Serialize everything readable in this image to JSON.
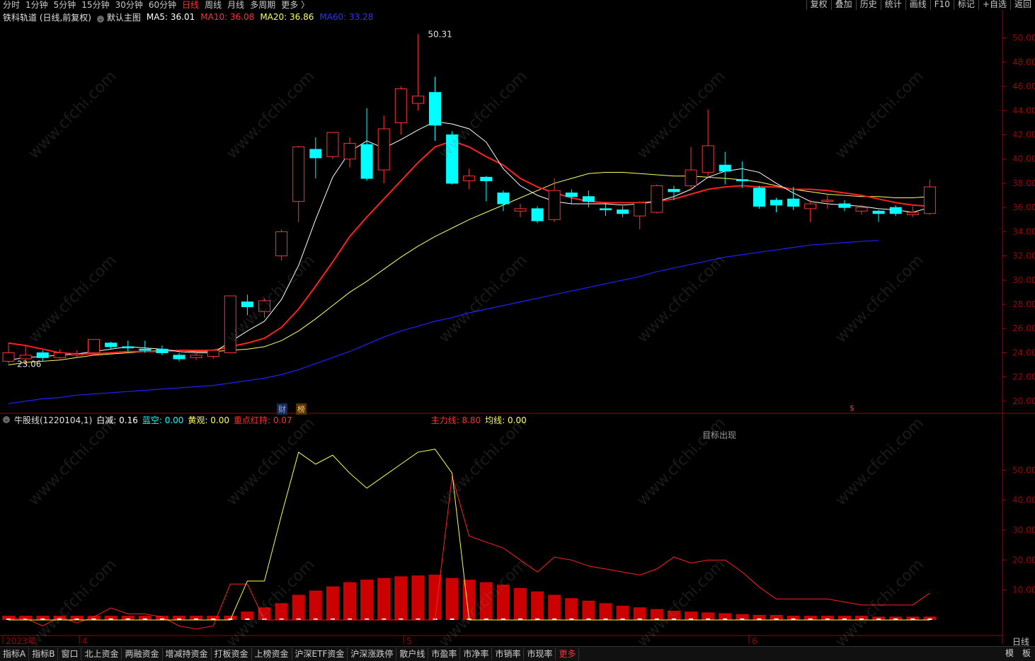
{
  "toolbar": {
    "items": [
      {
        "label": "分时",
        "active": false
      },
      {
        "label": "1分钟",
        "active": false
      },
      {
        "label": "5分钟",
        "active": false
      },
      {
        "label": "15分钟",
        "active": false
      },
      {
        "label": "30分钟",
        "active": false
      },
      {
        "label": "60分钟",
        "active": false
      },
      {
        "label": "日线",
        "active": true
      },
      {
        "label": "周线",
        "active": false
      },
      {
        "label": "月线",
        "active": false
      },
      {
        "label": "多周期",
        "active": false
      },
      {
        "label": "更多 〉",
        "active": false
      }
    ],
    "right": [
      "复权",
      "叠加",
      "历史",
      "统计",
      "画线",
      "F10",
      "标记",
      "+自选",
      "返回"
    ]
  },
  "main_header": {
    "stock": "铁科轨道 (日线,前复权)",
    "template": "默认主图",
    "ma5": "MA5: 36.01",
    "ma10": "MA10: 36.08",
    "ma20": "MA20: 36.86",
    "ma60": "MA60: 33.28"
  },
  "indicator_header": {
    "name": "牛股线(1220104,1)",
    "baijian": "白减: 0.16",
    "lankong": "蓝空: 0.00",
    "huangguan": "黄观: 0.00",
    "zhongdian": "重点红持: 0.07",
    "zhuli": "主力线: 8.80",
    "junxian": "均线: 0.00"
  },
  "annotations": {
    "high": "50.31",
    "low": "23.06",
    "target": "目标出现",
    "cai": "财",
    "bang": "榜",
    "dollar": "$"
  },
  "date_axis": [
    {
      "label": "2023年"
    },
    {
      "label": "4"
    },
    {
      "label": "5"
    },
    {
      "label": "6"
    }
  ],
  "period": "日线",
  "bottom_tabs": [
    "指标A",
    "指标B",
    "窗口",
    "北上资金",
    "两融资金",
    "增减持资金",
    "打板资金",
    "上榜资金",
    "沪深ETF资金",
    "沪深涨跌停",
    "散户线",
    "市盈率",
    "市净率",
    "市销率",
    "市现率",
    "更多"
  ],
  "bottom_right": [
    "模",
    "板"
  ],
  "watermark": "www.cfchi.com",
  "colors": {
    "up": "#ff3232",
    "down": "#00ffff",
    "ma5": "#ffffff",
    "ma10": "#ff2020",
    "ma20": "#ffff66",
    "ma60": "#2020ff",
    "axis": "#a00000"
  },
  "chart_data": {
    "type": "candlestick",
    "price_axis": {
      "ticks": [
        20.0,
        22.0,
        24.0,
        26.0,
        28.0,
        30.0,
        32.0,
        34.0,
        36.0,
        38.0,
        40.0,
        42.0,
        44.0,
        46.0,
        48.0,
        50.0
      ]
    },
    "indicator_axis": {
      "ticks": [
        10.0,
        20.0,
        30.0,
        40.0,
        50.0
      ]
    },
    "candles": [
      {
        "o": 23.3,
        "c": 24.0,
        "h": 24.8,
        "l": 23.1
      },
      {
        "o": 23.5,
        "c": 23.8,
        "h": 24.6,
        "l": 23.0
      },
      {
        "o": 24.0,
        "c": 23.6,
        "h": 24.2,
        "l": 23.3
      },
      {
        "o": 23.6,
        "c": 24.0,
        "h": 24.3,
        "l": 23.5
      },
      {
        "o": 23.8,
        "c": 23.9,
        "h": 24.2,
        "l": 23.6
      },
      {
        "o": 24.0,
        "c": 25.1,
        "h": 25.1,
        "l": 23.9
      },
      {
        "o": 24.8,
        "c": 24.5,
        "h": 24.9,
        "l": 24.3
      },
      {
        "o": 24.5,
        "c": 24.4,
        "h": 25.0,
        "l": 24.1
      },
      {
        "o": 24.3,
        "c": 24.2,
        "h": 25.0,
        "l": 24.0
      },
      {
        "o": 24.3,
        "c": 24.0,
        "h": 24.6,
        "l": 23.8
      },
      {
        "o": 23.8,
        "c": 23.5,
        "h": 24.0,
        "l": 23.3
      },
      {
        "o": 23.6,
        "c": 23.8,
        "h": 24.1,
        "l": 23.4
      },
      {
        "o": 23.7,
        "c": 24.2,
        "h": 24.3,
        "l": 23.5
      },
      {
        "o": 24.0,
        "c": 28.7,
        "h": 28.7,
        "l": 24.0
      },
      {
        "o": 28.2,
        "c": 27.8,
        "h": 28.8,
        "l": 27.1
      },
      {
        "o": 27.4,
        "c": 28.3,
        "h": 28.5,
        "l": 26.9
      },
      {
        "o": 32.0,
        "c": 34.0,
        "h": 34.2,
        "l": 31.6
      },
      {
        "o": 36.5,
        "c": 41.0,
        "h": 41.1,
        "l": 34.8
      },
      {
        "o": 40.8,
        "c": 40.1,
        "h": 41.8,
        "l": 38.4
      },
      {
        "o": 40.2,
        "c": 42.2,
        "h": 42.2,
        "l": 40.0
      },
      {
        "o": 40.0,
        "c": 41.3,
        "h": 41.8,
        "l": 39.3
      },
      {
        "o": 41.2,
        "c": 38.4,
        "h": 44.2,
        "l": 38.2
      },
      {
        "o": 39.1,
        "c": 42.5,
        "h": 43.6,
        "l": 38.0
      },
      {
        "o": 43.0,
        "c": 45.8,
        "h": 46.0,
        "l": 42.0
      },
      {
        "o": 44.6,
        "c": 45.2,
        "h": 50.31,
        "l": 44.0
      },
      {
        "o": 45.5,
        "c": 42.8,
        "h": 46.8,
        "l": 41.5
      },
      {
        "o": 42.0,
        "c": 38.0,
        "h": 42.3,
        "l": 37.9
      },
      {
        "o": 38.2,
        "c": 38.6,
        "h": 39.2,
        "l": 37.5
      },
      {
        "o": 38.5,
        "c": 38.2,
        "h": 38.6,
        "l": 36.5
      },
      {
        "o": 37.2,
        "c": 36.3,
        "h": 37.4,
        "l": 35.7
      },
      {
        "o": 35.7,
        "c": 35.9,
        "h": 36.3,
        "l": 35.2
      },
      {
        "o": 35.9,
        "c": 34.9,
        "h": 36.1,
        "l": 34.7
      },
      {
        "o": 35.0,
        "c": 37.4,
        "h": 38.4,
        "l": 34.8
      },
      {
        "o": 37.2,
        "c": 36.9,
        "h": 37.5,
        "l": 36.3
      },
      {
        "o": 36.9,
        "c": 36.5,
        "h": 37.4,
        "l": 36.0
      },
      {
        "o": 35.9,
        "c": 35.8,
        "h": 36.4,
        "l": 35.3
      },
      {
        "o": 35.8,
        "c": 35.5,
        "h": 36.1,
        "l": 35.2
      },
      {
        "o": 35.3,
        "c": 36.4,
        "h": 36.5,
        "l": 34.2
      },
      {
        "o": 35.6,
        "c": 37.8,
        "h": 37.9,
        "l": 35.5
      },
      {
        "o": 37.5,
        "c": 37.3,
        "h": 37.8,
        "l": 36.6
      },
      {
        "o": 37.8,
        "c": 39.1,
        "h": 41.0,
        "l": 37.4
      },
      {
        "o": 38.9,
        "c": 41.1,
        "h": 44.1,
        "l": 38.6
      },
      {
        "o": 39.5,
        "c": 39.0,
        "h": 40.6,
        "l": 37.9
      },
      {
        "o": 38.3,
        "c": 38.2,
        "h": 39.8,
        "l": 37.6
      },
      {
        "o": 37.6,
        "c": 36.1,
        "h": 37.8,
        "l": 35.9
      },
      {
        "o": 36.6,
        "c": 36.2,
        "h": 36.8,
        "l": 35.6
      },
      {
        "o": 36.7,
        "c": 36.1,
        "h": 37.7,
        "l": 35.8
      },
      {
        "o": 35.9,
        "c": 36.3,
        "h": 36.6,
        "l": 34.8
      },
      {
        "o": 36.5,
        "c": 36.6,
        "h": 37.0,
        "l": 35.9
      },
      {
        "o": 36.3,
        "c": 36.0,
        "h": 36.6,
        "l": 35.7
      },
      {
        "o": 35.7,
        "c": 36.0,
        "h": 36.2,
        "l": 35.4
      },
      {
        "o": 35.7,
        "c": 35.5,
        "h": 35.8,
        "l": 34.8
      },
      {
        "o": 36.0,
        "c": 35.5,
        "h": 36.2,
        "l": 35.3
      },
      {
        "o": 35.4,
        "c": 35.6,
        "h": 36.1,
        "l": 35.2
      },
      {
        "o": 35.5,
        "c": 37.7,
        "h": 38.3,
        "l": 35.4
      }
    ],
    "ma5": [
      23.4,
      23.6,
      23.7,
      23.8,
      23.9,
      24.1,
      24.3,
      24.5,
      24.4,
      24.3,
      24.1,
      24.0,
      24.0,
      24.9,
      25.8,
      26.6,
      28.4,
      31.2,
      35.0,
      38.5,
      40.6,
      41.5,
      40.9,
      41.6,
      42.4,
      43.1,
      42.9,
      42.5,
      41.4,
      39.2,
      37.8,
      37.0,
      36.5,
      36.3,
      36.3,
      36.3,
      36.2,
      36.3,
      36.5,
      36.9,
      37.5,
      38.5,
      39.0,
      39.2,
      38.9,
      38.0,
      37.2,
      36.5,
      36.3,
      36.2,
      36.1,
      35.9,
      35.8,
      35.6,
      36.0
    ],
    "ma10": [
      24.8,
      24.6,
      24.3,
      24.0,
      23.9,
      23.9,
      24.0,
      24.1,
      24.1,
      24.1,
      24.2,
      24.2,
      24.2,
      24.5,
      24.8,
      25.2,
      26.1,
      27.6,
      29.5,
      31.5,
      33.6,
      35.2,
      36.7,
      38.2,
      39.7,
      41.0,
      41.5,
      41.0,
      40.2,
      39.5,
      38.4,
      37.7,
      37.2,
      36.8,
      36.5,
      36.4,
      36.4,
      36.4,
      36.5,
      36.7,
      37.1,
      37.5,
      37.7,
      37.8,
      37.7,
      37.7,
      37.5,
      37.5,
      37.4,
      37.2,
      37.0,
      36.7,
      36.4,
      36.2,
      36.1
    ],
    "ma20": [
      23.0,
      23.2,
      23.3,
      23.4,
      23.6,
      23.8,
      23.9,
      24.0,
      24.1,
      24.2,
      24.2,
      24.1,
      24.1,
      24.2,
      24.3,
      24.5,
      25.0,
      25.8,
      26.8,
      27.9,
      29.0,
      29.9,
      30.9,
      31.9,
      32.8,
      33.6,
      34.3,
      35.0,
      35.6,
      36.2,
      36.8,
      37.4,
      38.0,
      38.4,
      38.8,
      38.9,
      38.9,
      38.8,
      38.7,
      38.6,
      38.6,
      38.5,
      38.4,
      38.3,
      38.1,
      37.8,
      37.5,
      37.3,
      37.1,
      37.0,
      36.9,
      36.9,
      36.8,
      36.8,
      36.9
    ],
    "ma60": [
      19.8,
      20.0,
      20.2,
      20.3,
      20.5,
      20.6,
      20.7,
      20.8,
      20.9,
      21.0,
      21.1,
      21.2,
      21.3,
      21.5,
      21.7,
      21.9,
      22.2,
      22.6,
      23.1,
      23.6,
      24.1,
      24.7,
      25.3,
      25.8,
      26.2,
      26.6,
      26.9,
      27.3,
      27.6,
      27.9,
      28.2,
      28.5,
      28.8,
      29.1,
      29.4,
      29.7,
      30.0,
      30.3,
      30.7,
      31.0,
      31.3,
      31.6,
      31.9,
      32.1,
      32.3,
      32.5,
      32.7,
      32.9,
      33.0,
      33.1,
      33.2,
      33.28
    ],
    "zhuli_yellow": [
      0,
      0,
      0,
      0,
      0,
      0,
      0,
      0,
      0,
      0,
      0,
      0,
      0,
      0,
      13,
      13,
      35,
      56,
      52,
      55,
      49,
      44,
      48,
      52,
      56,
      57,
      49,
      0,
      0,
      0,
      0,
      0,
      0,
      0,
      0,
      0,
      0,
      0,
      0,
      0,
      0,
      0,
      0,
      0,
      0,
      0,
      0,
      0,
      0,
      0,
      0,
      0,
      0,
      0,
      0
    ],
    "zhuli_red": [
      0.5,
      0.5,
      -2,
      1,
      -1,
      1,
      4,
      2,
      2,
      1,
      -2,
      -3,
      -2,
      12,
      12,
      0,
      0,
      0,
      0,
      0,
      0,
      0,
      0,
      0,
      0,
      0,
      48,
      28,
      26,
      24,
      20,
      16,
      21,
      20,
      18,
      17,
      16,
      15,
      17,
      21,
      19,
      20,
      20,
      16,
      11,
      7,
      7,
      7,
      7,
      6,
      5,
      5,
      5,
      5,
      9
    ],
    "red_volume": [
      0.5,
      0.5,
      0.5,
      0.5,
      0.5,
      0.5,
      0.5,
      0.5,
      0.5,
      0.5,
      0.5,
      0.5,
      0.5,
      0.5,
      1,
      1.5,
      2,
      3,
      3.5,
      4,
      4.5,
      4.8,
      5,
      5.2,
      5.3,
      5.4,
      5.0,
      4.8,
      4.5,
      4.2,
      3.8,
      3.4,
      3.0,
      2.6,
      2.3,
      2.0,
      1.7,
      1.5,
      1.3,
      1.1,
      1.0,
      0.9,
      0.8,
      0.7,
      0.6,
      0.6,
      0.5,
      0.5,
      0.5,
      0.5,
      0.5,
      0.4,
      0.4,
      0.4,
      0.4
    ]
  }
}
